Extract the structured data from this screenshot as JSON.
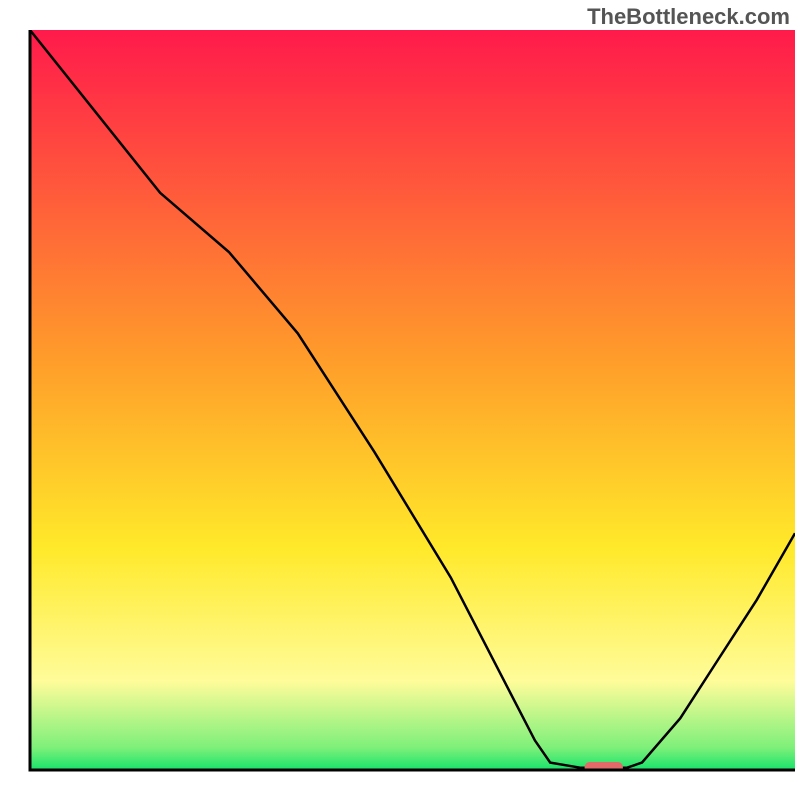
{
  "watermark": "TheBottleneck.com",
  "chart_data": {
    "type": "line",
    "title": "",
    "xlabel": "",
    "ylabel": "",
    "xlim": [
      0,
      100
    ],
    "ylim": [
      0,
      100
    ],
    "note": "No axis tick labels are rendered; values are percent-of-plot heuristics.",
    "gradient_stops": [
      {
        "offset": 0.0,
        "color": "#ff1a4b"
      },
      {
        "offset": 0.45,
        "color": "#ff9e2a"
      },
      {
        "offset": 0.7,
        "color": "#ffe92a"
      },
      {
        "offset": 0.88,
        "color": "#fffc9a"
      },
      {
        "offset": 0.97,
        "color": "#7df07a"
      },
      {
        "offset": 1.0,
        "color": "#17e36a"
      }
    ],
    "curve_points_xy": [
      [
        0.0,
        100.0
      ],
      [
        17.0,
        78.0
      ],
      [
        26.0,
        70.0
      ],
      [
        35.0,
        59.0
      ],
      [
        45.0,
        43.0
      ],
      [
        55.0,
        26.0
      ],
      [
        62.0,
        12.0
      ],
      [
        66.0,
        4.0
      ],
      [
        68.0,
        1.0
      ],
      [
        72.0,
        0.3
      ],
      [
        78.0,
        0.3
      ],
      [
        80.0,
        1.0
      ],
      [
        85.0,
        7.0
      ],
      [
        90.0,
        15.0
      ],
      [
        95.0,
        23.0
      ],
      [
        100.0,
        32.0
      ]
    ],
    "marker": {
      "x": 75.0,
      "y": 0.4,
      "width_pct": 5.0,
      "color": "#e46a6a"
    }
  }
}
